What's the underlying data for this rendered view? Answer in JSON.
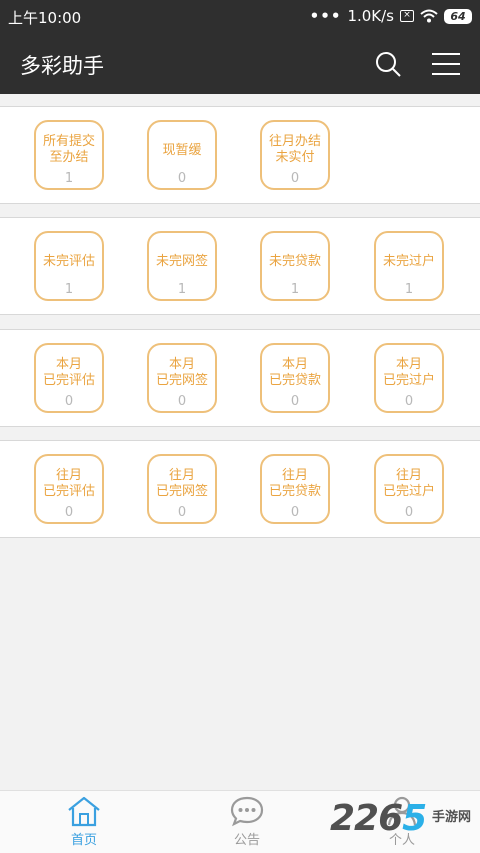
{
  "status_bar": {
    "time": "上午10:00",
    "dots": "•••",
    "speed": "1.0K/s",
    "battery": "64"
  },
  "app_bar": {
    "title": "多彩助手"
  },
  "sections": [
    {
      "tiles": [
        {
          "line1": "所有提交",
          "line2": "至办结",
          "count": "1"
        },
        {
          "line1": "现暂缓",
          "line2": "",
          "count": "0"
        },
        {
          "line1": "往月办结",
          "line2": "未实付",
          "count": "0"
        }
      ]
    },
    {
      "tiles": [
        {
          "line1": "未完评估",
          "line2": "",
          "count": "1"
        },
        {
          "line1": "未完网签",
          "line2": "",
          "count": "1"
        },
        {
          "line1": "未完贷款",
          "line2": "",
          "count": "1"
        },
        {
          "line1": "未完过户",
          "line2": "",
          "count": "1"
        }
      ]
    },
    {
      "tiles": [
        {
          "line1": "本月",
          "line2": "已完评估",
          "count": "0"
        },
        {
          "line1": "本月",
          "line2": "已完网签",
          "count": "0"
        },
        {
          "line1": "本月",
          "line2": "已完贷款",
          "count": "0"
        },
        {
          "line1": "本月",
          "line2": "已完过户",
          "count": "0"
        }
      ]
    },
    {
      "tiles": [
        {
          "line1": "往月",
          "line2": "已完评估",
          "count": "0"
        },
        {
          "line1": "往月",
          "line2": "已完网签",
          "count": "0"
        },
        {
          "line1": "往月",
          "line2": "已完贷款",
          "count": "0"
        },
        {
          "line1": "往月",
          "line2": "已完过户",
          "count": "0"
        }
      ]
    }
  ],
  "tabbar": {
    "home": "首页",
    "notice": "公告",
    "me": "个人"
  },
  "watermark": {
    "digits_a": "22",
    "digit_b": "6",
    "digit_c": "5",
    "sub": "手游网"
  },
  "colors": {
    "bar": "#2f2f2f",
    "tile_border": "#eec07a",
    "tile_text": "#eaa441",
    "active_tab": "#3aa0e0"
  }
}
